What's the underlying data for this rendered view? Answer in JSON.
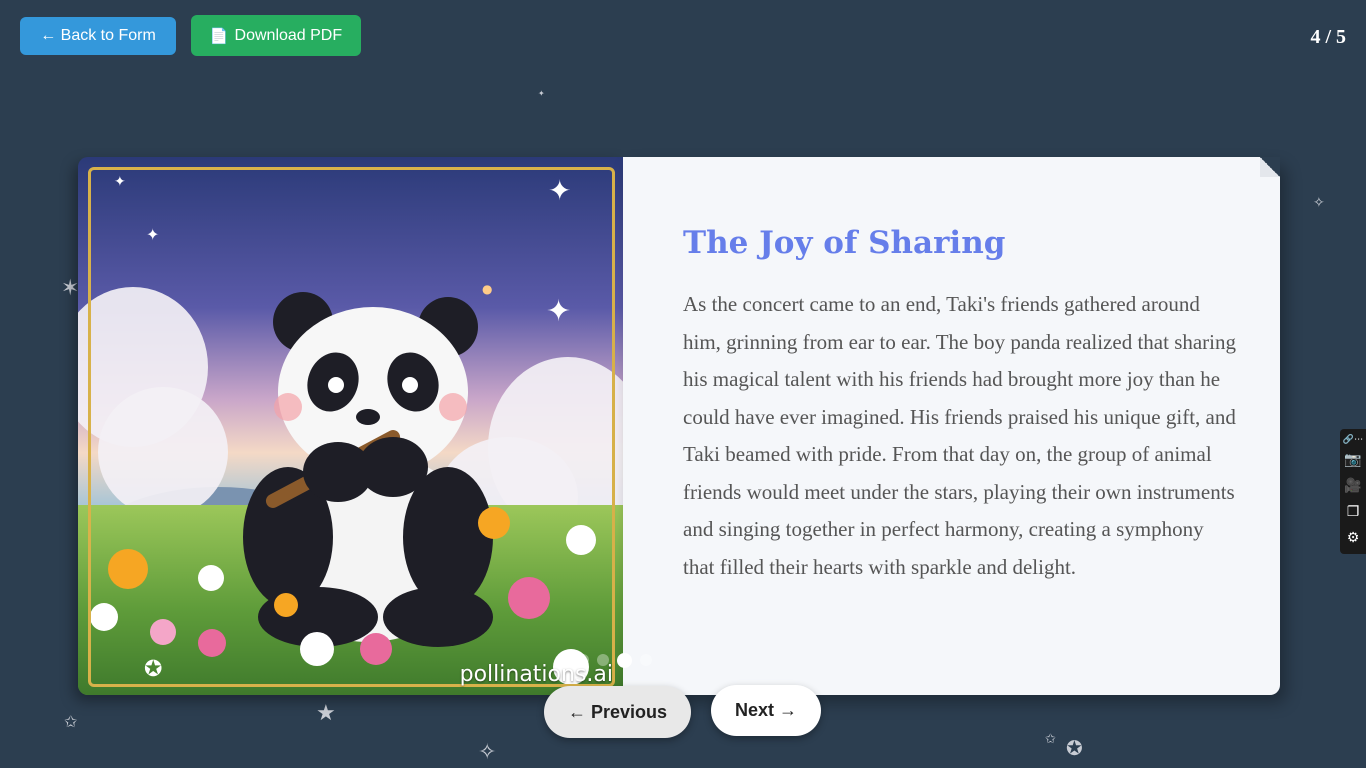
{
  "header": {
    "back_label": "← Back to Form",
    "download_label": "Download PDF",
    "download_icon": "document-icon",
    "page_counter": "4 / 5"
  },
  "book": {
    "title": "The Joy of Sharing",
    "text": "As the concert came to an end, Taki's friends gathered around him, grinning from ear to ear. The boy panda realized that sharing his magical talent with his friends had brought more joy than he could have ever imagined. His friends praised his unique gift, and Taki beamed with pride. From that day on, the group of animal friends would meet under the stars, playing their own instruments and singing together in perfect harmony, creating a symphony that filled their hearts with sparkle and delight.",
    "illustration_watermark": "pollinations.ai",
    "current_page": 4,
    "total_pages": 5
  },
  "nav": {
    "previous_label": "← Previous",
    "next_label": "Next →"
  },
  "toolbar": {
    "items": [
      "link-icon",
      "camera-icon",
      "video-icon",
      "window-icon",
      "gear-icon"
    ]
  },
  "colors": {
    "background": "#2c3e50",
    "back_button": "#3498db",
    "download_button": "#27ae60",
    "title": "#667eea",
    "frame": "#d8b24a"
  }
}
